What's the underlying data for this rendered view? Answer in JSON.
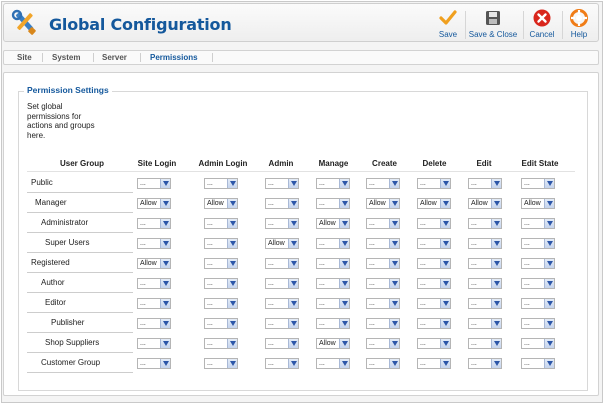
{
  "header": {
    "title": "Global Configuration",
    "app_icon": "tools-wrench-screwdriver-icon"
  },
  "toolbar": [
    {
      "label": "Save",
      "icon": "checkmark-icon"
    },
    {
      "label": "Save & Close",
      "icon": "floppy-disk-icon"
    },
    {
      "label": "Cancel",
      "icon": "cancel-x-icon"
    },
    {
      "label": "Help",
      "icon": "lifebuoy-help-icon"
    }
  ],
  "tabs": [
    {
      "label": "Site",
      "active": false
    },
    {
      "label": "System",
      "active": false
    },
    {
      "label": "Server",
      "active": false
    },
    {
      "label": "Permissions",
      "active": true
    }
  ],
  "permissions": {
    "legend": "Permission Settings",
    "description": "Set global permissions for actions and groups here.",
    "columns": [
      "User Group",
      "Site Login",
      "Admin Login",
      "Admin",
      "Manage",
      "Create",
      "Delete",
      "Edit",
      "Edit State"
    ],
    "rows": [
      {
        "group": "Public",
        "values": [
          "...",
          "...",
          "...",
          "...",
          "...",
          "...",
          "...",
          "..."
        ]
      },
      {
        "group": "Manager",
        "values": [
          "Allow",
          "Allow",
          "...",
          "...",
          "Allow",
          "Allow",
          "Allow",
          "Allow"
        ]
      },
      {
        "group": "Administrator",
        "values": [
          "...",
          "...",
          "...",
          "Allow",
          "...",
          "...",
          "...",
          "..."
        ]
      },
      {
        "group": "Super Users",
        "values": [
          "...",
          "...",
          "Allow",
          "...",
          "...",
          "...",
          "...",
          "..."
        ]
      },
      {
        "group": "Registered",
        "values": [
          "Allow",
          "...",
          "...",
          "...",
          "...",
          "...",
          "...",
          "..."
        ]
      },
      {
        "group": "Author",
        "values": [
          "...",
          "...",
          "...",
          "...",
          "...",
          "...",
          "...",
          "..."
        ]
      },
      {
        "group": "Editor",
        "values": [
          "...",
          "...",
          "...",
          "...",
          "...",
          "...",
          "...",
          "..."
        ]
      },
      {
        "group": "Publisher",
        "values": [
          "...",
          "...",
          "...",
          "...",
          "...",
          "...",
          "...",
          "..."
        ]
      },
      {
        "group": "Shop Suppliers",
        "values": [
          "...",
          "...",
          "...",
          "Allow",
          "...",
          "...",
          "...",
          "..."
        ]
      },
      {
        "group": "Customer Group",
        "values": [
          "...",
          "...",
          "...",
          "...",
          "...",
          "...",
          "...",
          "..."
        ]
      }
    ]
  },
  "colors": {
    "accent": "#14589c",
    "save_check": "#f0a01f",
    "cancel_red": "#d9261c",
    "help_orange": "#f07c16"
  }
}
